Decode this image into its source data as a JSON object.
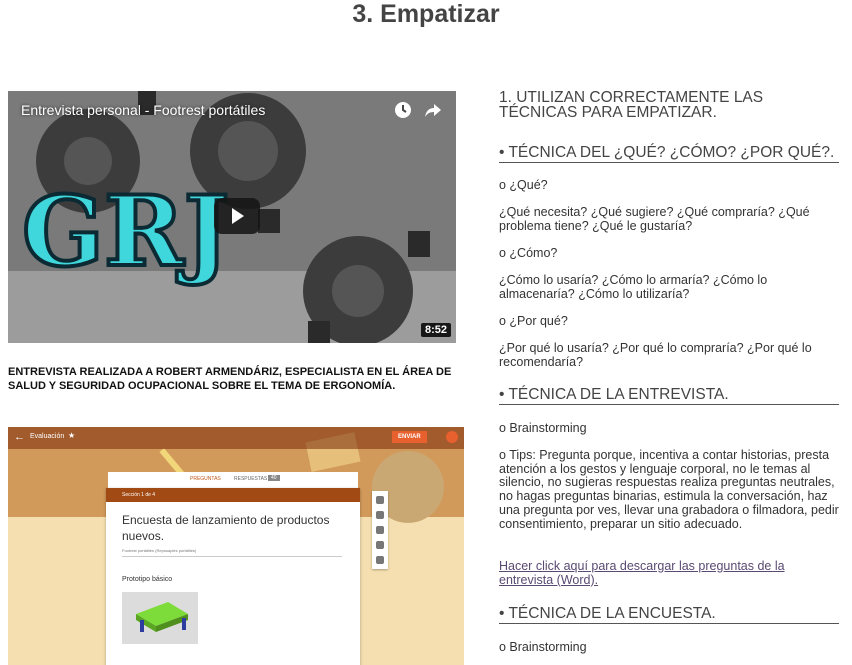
{
  "page": {
    "title": "3. Empatizar"
  },
  "video": {
    "title": "Entrevista personal - Footrest portátiles",
    "duration": "8:52",
    "thumbnail_text": "GRJ"
  },
  "caption": "ENTREVISTA REALIZADA A ROBERT ARMENDÁRIZ, ESPECIALISTA EN EL ÁREA DE SALUD Y SEGURIDAD OCUPACIONAL SOBRE EL TEMA DE ERGONOMÍA.",
  "forms_screenshot": {
    "title": "Evaluación",
    "send_label": "ENVIAR",
    "tab_questions": "PREGUNTAS",
    "tab_responses": "RESPUESTAS",
    "responses_count": "40",
    "section": "Sección 1 de 4",
    "form_title": "Encuesta de lanzamiento de productos nuevos.",
    "form_description": "Footrest portátiles (Reposapiés portátiles)",
    "question_label": "Prototipo básico"
  },
  "content": {
    "lead": "1. UTILIZAN CORRECTAMENTE LAS TÉCNICAS PARA EMPATIZAR.",
    "section1_heading": "• TÉCNICA DEL ¿QUÉ? ¿CÓMO? ¿POR QUÉ?.",
    "q_que": "o ¿Qué?",
    "q_que_list": " ¿Qué necesita?  ¿Qué sugiere?  ¿Qué compraría?  ¿Qué problema tiene?  ¿Qué le gustaría?",
    "q_como": "o ¿Cómo?",
    "q_como_list": " ¿Cómo lo usaría?  ¿Cómo lo armaría?  ¿Cómo lo almacenaría?  ¿Cómo lo utilizaría?",
    "q_porque": "o ¿Por qué?",
    "q_porque_list": " ¿Por qué lo usaría?  ¿Por qué lo compraría?  ¿Por qué lo recomendaría?",
    "section2_heading": "• TÉCNICA DE LA ENTREVISTA.",
    "brainstorming_1": "o Brainstorming",
    "tips": "o Tips: Pregunta porque, incentiva a contar historias, presta atención a los gestos y lenguaje corporal, no le temas al silencio, no sugieras respuestas realiza preguntas neutrales, no hagas preguntas binarias, estimula la conversación, haz una pregunta por ves, llevar una grabadora o filmadora, pedir consentimiento, preparar un sitio adecuado.",
    "download_link": "Hacer click aquí para descargar las preguntas de la entrevista (Word).",
    "section3_heading": "• TÉCNICA DE LA ENCUESTA.",
    "brainstorming_2": "o Brainstorming"
  },
  "colors": {
    "link": "#5a4a72",
    "forms_accent": "#a24a14",
    "send_button": "#e8602e"
  }
}
